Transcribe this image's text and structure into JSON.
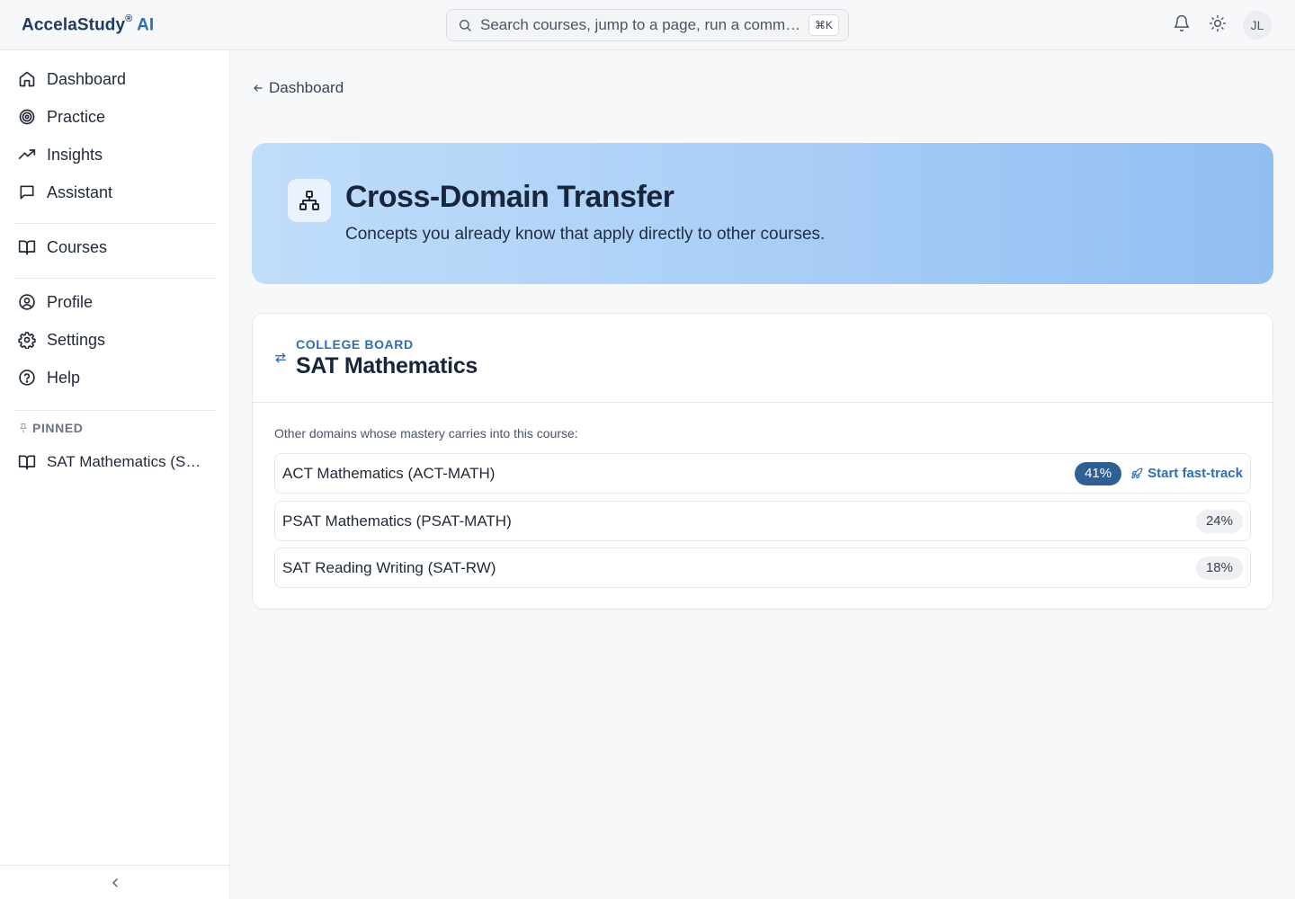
{
  "brand": {
    "name": "AccelaStudy",
    "reg": "®",
    "suffix": "AI"
  },
  "search": {
    "placeholder": "Search courses, jump to a page, run a comma…",
    "shortcut": "⌘K"
  },
  "header": {
    "avatar_initials": "JL",
    "icons": [
      "bell-icon",
      "sun-icon"
    ]
  },
  "sidebar": {
    "items": [
      {
        "label": "Dashboard",
        "icon": "home-icon"
      },
      {
        "label": "Practice",
        "icon": "target-icon"
      },
      {
        "label": "Insights",
        "icon": "trending-up-icon"
      },
      {
        "label": "Assistant",
        "icon": "message-icon"
      },
      {
        "label": "Courses",
        "icon": "book-icon"
      },
      {
        "label": "Profile",
        "icon": "user-circle-icon"
      },
      {
        "label": "Settings",
        "icon": "gear-icon"
      },
      {
        "label": "Help",
        "icon": "help-circle-icon"
      }
    ],
    "pinned_heading": "PINNED",
    "pinned": [
      {
        "label": "SAT Mathematics (SAT-MATH)",
        "icon": "book-icon"
      }
    ]
  },
  "back": {
    "label": "Dashboard"
  },
  "hero": {
    "title": "Cross-Domain Transfer",
    "subtitle": "Concepts you already know that apply directly to other courses."
  },
  "card": {
    "provider": "COLLEGE BOARD",
    "course": "SAT Mathematics",
    "intro": "Other domains whose mastery carries into this course:",
    "domains": [
      {
        "name": "ACT Mathematics (ACT-MATH)",
        "percent": "41%",
        "action": "Start fast-track"
      },
      {
        "name": "PSAT Mathematics (PSAT-MATH)",
        "percent": "24%"
      },
      {
        "name": "SAT Reading Writing (SAT-RW)",
        "percent": "18%"
      }
    ]
  },
  "colors": {
    "accent": "#2f6db5",
    "badge_strong": "#2f6094",
    "hero_gradient": [
      "#c0ddfa",
      "#92bef2"
    ]
  }
}
